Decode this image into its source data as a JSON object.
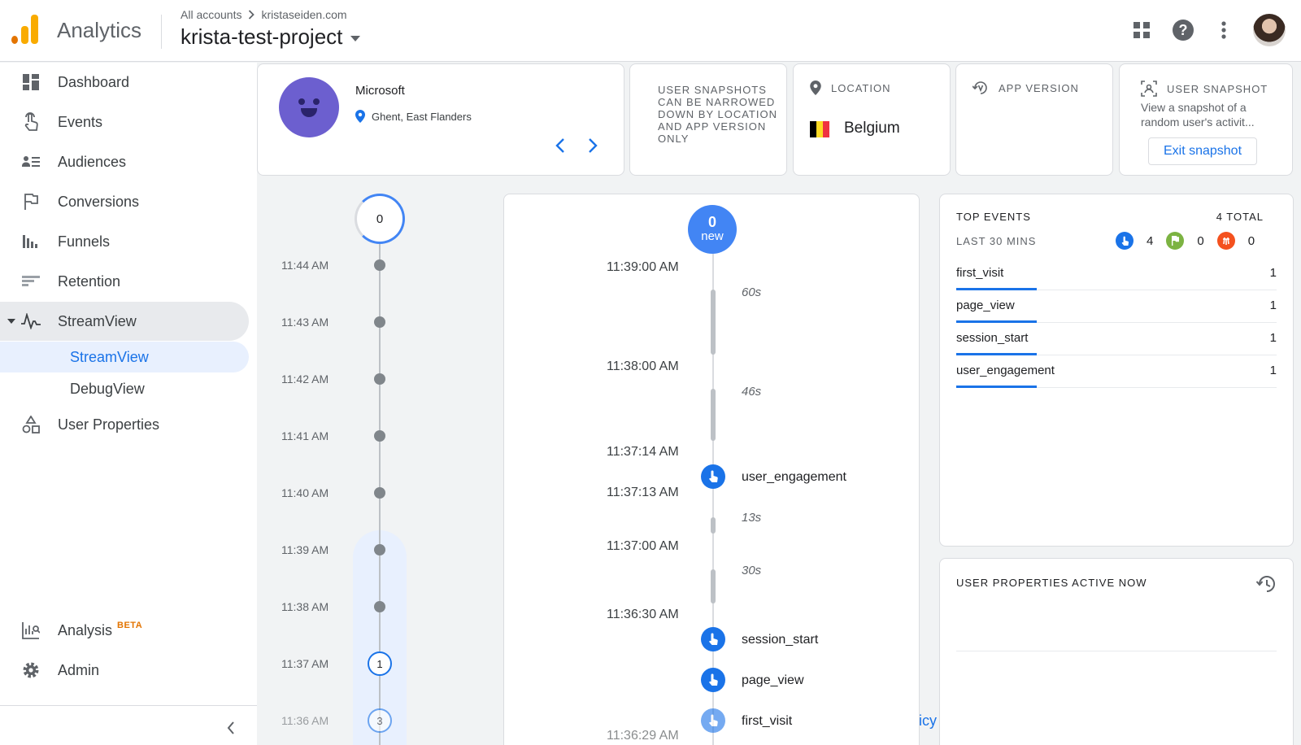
{
  "header": {
    "product": "Analytics",
    "breadcrumb_root": "All accounts",
    "breadcrumb_account": "kristaseiden.com",
    "project": "krista-test-project",
    "icons": [
      "apps-grid-icon",
      "help-icon",
      "more-vert-icon",
      "account-avatar"
    ]
  },
  "sidebar": {
    "items": [
      {
        "label": "Dashboard",
        "icon": "dashboard-icon"
      },
      {
        "label": "Events",
        "icon": "touch-icon"
      },
      {
        "label": "Audiences",
        "icon": "audience-icon"
      },
      {
        "label": "Conversions",
        "icon": "flag-icon"
      },
      {
        "label": "Funnels",
        "icon": "funnel-icon"
      },
      {
        "label": "Retention",
        "icon": "retention-icon"
      },
      {
        "label": "StreamView",
        "icon": "pulse-icon"
      }
    ],
    "sub_items": [
      {
        "label": "StreamView"
      },
      {
        "label": "DebugView"
      }
    ],
    "user_properties": "User Properties",
    "analysis": "Analysis",
    "analysis_badge": "BETA",
    "admin": "Admin"
  },
  "user_card": {
    "device": "Microsoft",
    "location": "Ghent, East Flanders"
  },
  "snapshot_note": "USER SNAPSHOTS CAN BE NARROWED DOWN BY LOCATION AND APP VERSION ONLY",
  "location_card": {
    "label": "LOCATION",
    "country": "Belgium",
    "flag_colors": [
      "#000000",
      "#fdda24",
      "#ef3340"
    ]
  },
  "app_version_card": {
    "label": "APP VERSION"
  },
  "snapshot_card": {
    "label": "USER SNAPSHOT",
    "description": "View a snapshot of a random user's activit...",
    "exit_button": "Exit snapshot"
  },
  "minute_timeline": {
    "current_count": "0",
    "rows": [
      {
        "time": "11:44 AM",
        "count": null
      },
      {
        "time": "11:43 AM",
        "count": null
      },
      {
        "time": "11:42 AM",
        "count": null
      },
      {
        "time": "11:41 AM",
        "count": null
      },
      {
        "time": "11:40 AM",
        "count": null
      },
      {
        "time": "11:39 AM",
        "count": null
      },
      {
        "time": "11:38 AM",
        "count": null
      },
      {
        "time": "11:37 AM",
        "count": "1"
      },
      {
        "time": "11:36 AM",
        "count": "3"
      }
    ]
  },
  "seconds_stream": {
    "new_count": "0",
    "new_label": "new",
    "times": [
      "11:39:00 AM",
      "11:38:00 AM",
      "11:37:14 AM",
      "11:37:13 AM",
      "11:37:00 AM",
      "11:36:30 AM",
      "11:36:29 AM"
    ],
    "gaps": [
      "60s",
      "46s",
      "13s",
      "30s"
    ],
    "events": [
      "user_engagement",
      "session_start",
      "page_view",
      "first_visit"
    ],
    "cut_text": "icy"
  },
  "top_events": {
    "title": "TOP EVENTS",
    "total": "4 TOTAL",
    "subtitle": "LAST 30 MINS",
    "summary": [
      {
        "icon": "touch-icon",
        "color": "#1a73e8",
        "value": "4"
      },
      {
        "icon": "conversion-flag-icon",
        "color": "#7cb342",
        "value": "0"
      },
      {
        "icon": "error-icon",
        "color": "#f4511e",
        "value": "0"
      }
    ],
    "rows": [
      {
        "name": "first_visit",
        "count": "1"
      },
      {
        "name": "page_view",
        "count": "1"
      },
      {
        "name": "session_start",
        "count": "1"
      },
      {
        "name": "user_engagement",
        "count": "1"
      }
    ]
  },
  "user_properties_card": {
    "title": "USER PROPERTIES ACTIVE NOW"
  }
}
